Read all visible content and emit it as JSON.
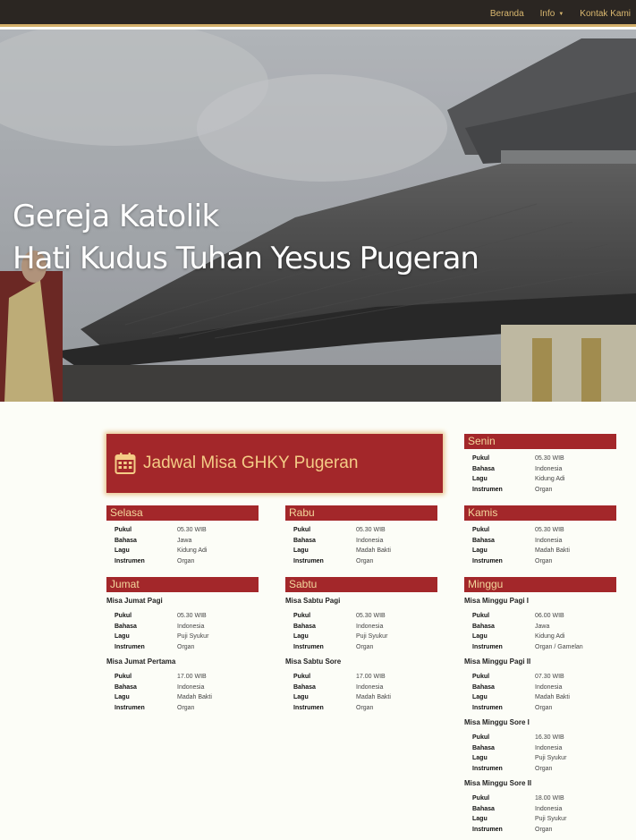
{
  "nav": {
    "items": [
      "Beranda",
      "Info",
      "Kontak Kami"
    ]
  },
  "hero": {
    "line1": "Gereja Katolik",
    "line2": "Hati Kudus Tuhan Yesus Pugeran"
  },
  "banner": {
    "icon": "calendar-icon",
    "title": "Jadwal Misa GHKY Pugeran"
  },
  "labels": {
    "pukul": "Pukul",
    "bahasa": "Bahasa",
    "lagu": "Lagu",
    "instrumen": "Instrumen"
  },
  "days": {
    "senin": {
      "name": "Senin",
      "masses": [
        {
          "pukul": "05.30 WIB",
          "bahasa": "Indonesia",
          "lagu": "Kidung Adi",
          "instrumen": "Organ"
        }
      ]
    },
    "selasa": {
      "name": "Selasa",
      "masses": [
        {
          "pukul": "05.30 WIB",
          "bahasa": "Jawa",
          "lagu": "Kidung Adi",
          "instrumen": "Organ"
        }
      ]
    },
    "rabu": {
      "name": "Rabu",
      "masses": [
        {
          "pukul": "05.30 WIB",
          "bahasa": "Indonesia",
          "lagu": "Madah Bakti",
          "instrumen": "Organ"
        }
      ]
    },
    "kamis": {
      "name": "Kamis",
      "masses": [
        {
          "pukul": "05.30 WIB",
          "bahasa": "Indonesia",
          "lagu": "Madah Bakti",
          "instrumen": "Organ"
        }
      ]
    },
    "jumat": {
      "name": "Jumat",
      "masses": [
        {
          "title": "Misa Jumat Pagi",
          "pukul": "05.30 WIB",
          "bahasa": "Indonesia",
          "lagu": "Puji Syukur",
          "instrumen": "Organ"
        },
        {
          "title": "Misa Jumat Pertama",
          "pukul": "17.00 WIB",
          "bahasa": "Indonesia",
          "lagu": "Madah Bakti",
          "instrumen": "Organ"
        }
      ]
    },
    "sabtu": {
      "name": "Sabtu",
      "masses": [
        {
          "title": "Misa Sabtu Pagi",
          "pukul": "05.30 WIB",
          "bahasa": "Indonesia",
          "lagu": "Puji Syukur",
          "instrumen": "Organ"
        },
        {
          "title": "Misa Sabtu Sore",
          "pukul": "17.00 WIB",
          "bahasa": "Indonesia",
          "lagu": "Madah Bakti",
          "instrumen": "Organ"
        }
      ]
    },
    "minggu": {
      "name": "Minggu",
      "masses": [
        {
          "title": "Misa Minggu Pagi I",
          "pukul": "06.00 WIB",
          "bahasa": "Jawa",
          "lagu": "Kidung Adi",
          "instrumen": "Organ / Gamelan"
        },
        {
          "title": "Misa Minggu Pagi II",
          "pukul": "07.30 WIB",
          "bahasa": "Indonesia",
          "lagu": "Madah Bakti",
          "instrumen": "Organ"
        },
        {
          "title": "Misa Minggu Sore I",
          "pukul": "16.30 WIB",
          "bahasa": "Indonesia",
          "lagu": "Puji Syukur",
          "instrumen": "Organ"
        },
        {
          "title": "Misa Minggu Sore II",
          "pukul": "18.00 WIB",
          "bahasa": "Indonesia",
          "lagu": "Puji Syukur",
          "instrumen": "Organ"
        }
      ]
    }
  }
}
